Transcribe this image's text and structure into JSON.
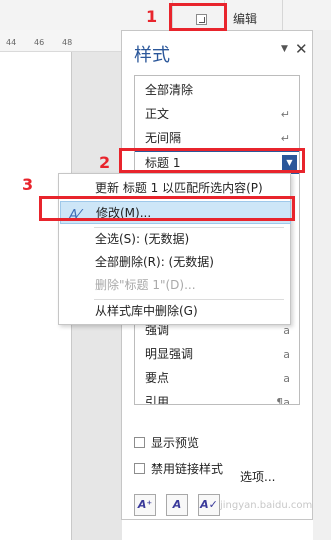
{
  "ribbon": {
    "edit_label": "编辑"
  },
  "ruler": {
    "ticks": [
      "44",
      "46",
      "48"
    ]
  },
  "styles_pane": {
    "title": "样式",
    "items": [
      {
        "label": "全部清除",
        "marker": ""
      },
      {
        "label": "正文",
        "marker": "↵"
      },
      {
        "label": "无间隔",
        "marker": "↵"
      },
      {
        "label": "标题 1",
        "marker": ""
      },
      {
        "label": "强调",
        "marker": "a"
      },
      {
        "label": "明显强调",
        "marker": "a"
      },
      {
        "label": "要点",
        "marker": "a"
      },
      {
        "label": "引用",
        "marker": "¶a"
      }
    ],
    "show_preview_label": "显示预览",
    "disable_linked_label": "禁用链接样式",
    "options_label": "选项..."
  },
  "context_menu": {
    "items": [
      {
        "label": "更新 标题 1 以匹配所选内容(P)"
      },
      {
        "label": "修改(M)..."
      },
      {
        "label": "全选(S): (无数据)"
      },
      {
        "label": "全部删除(R): (无数据)"
      },
      {
        "label": "删除\"标题 1\"(D)..."
      },
      {
        "label": "从样式库中删除(G)"
      }
    ]
  },
  "annotations": [
    "1",
    "2",
    "3"
  ],
  "watermark": "jingyan.baidu.com"
}
